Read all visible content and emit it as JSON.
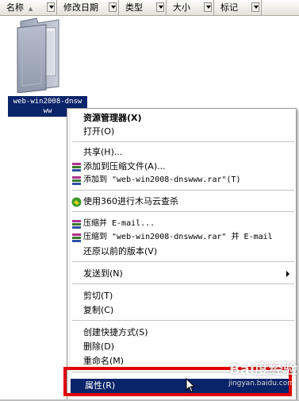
{
  "columns": [
    {
      "label": "名称"
    },
    {
      "label": "修改日期"
    },
    {
      "label": "类型"
    },
    {
      "label": "大小"
    },
    {
      "label": "标记"
    }
  ],
  "folder": {
    "name_line1": "web-win2008-dnsw",
    "name_line2": "ww"
  },
  "menu": {
    "explorer": "资源管理器(X)",
    "open": "打开(O)",
    "share": "共享(H)...",
    "add_archive": "添加到压缩文件(A)...",
    "add_named": "添加到 \"web-win2008-dnswww.rar\"(T)",
    "scan360": "使用360进行木马云查杀",
    "compress_email": "压缩并 E-mail...",
    "compress_named_email": "压缩到 \"web-win2008-dnswww.rar\" 并 E-mail",
    "restore": "还原以前的版本(V)",
    "send_to": "发送到(N)",
    "cut": "剪切(T)",
    "copy": "复制(C)",
    "shortcut": "创建快捷方式(S)",
    "delete": "删除(D)",
    "rename": "重命名(M)",
    "properties": "属性(R)"
  },
  "watermark": {
    "logo": "Bai度经验",
    "url": "jingyan.baidu.com"
  },
  "colors": {
    "selection": "#0a246a",
    "highlight_box": "#e00000"
  }
}
